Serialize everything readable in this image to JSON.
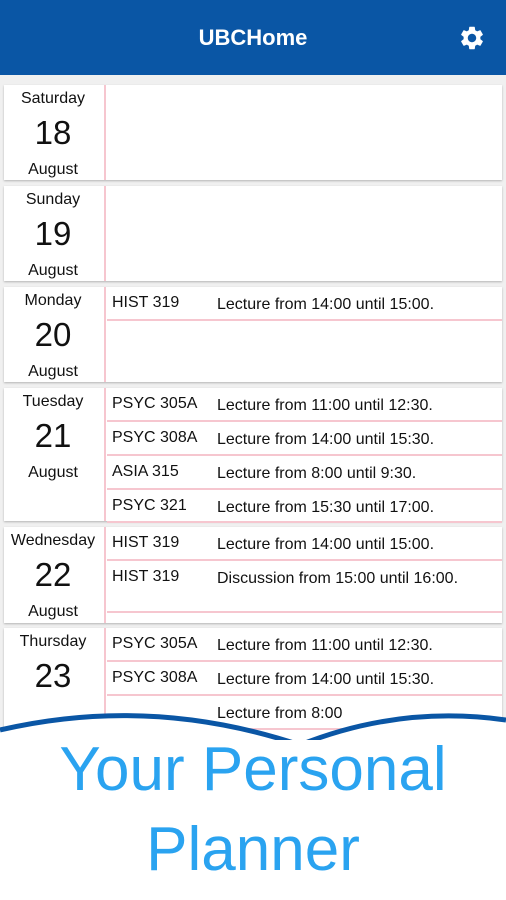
{
  "app": {
    "title": "UBCHome",
    "settings_icon": "gear-icon"
  },
  "days": [
    {
      "dow": "Saturday",
      "day": "18",
      "month": "August",
      "events": []
    },
    {
      "dow": "Sunday",
      "day": "19",
      "month": "August",
      "events": []
    },
    {
      "dow": "Monday",
      "day": "20",
      "month": "August",
      "events": [
        {
          "code": "HIST 319",
          "desc": "Lecture from 14:00 until 15:00."
        }
      ]
    },
    {
      "dow": "Tuesday",
      "day": "21",
      "month": "August",
      "events": [
        {
          "code": "PSYC 305A",
          "desc": "Lecture from 11:00 until 12:30."
        },
        {
          "code": "PSYC 308A",
          "desc": "Lecture from 14:00 until 15:30."
        },
        {
          "code": "ASIA 315",
          "desc": "Lecture from 8:00 until 9:30."
        },
        {
          "code": "PSYC 321",
          "desc": "Lecture from 15:30 until 17:00."
        }
      ]
    },
    {
      "dow": "Wednesday",
      "day": "22",
      "month": "August",
      "events": [
        {
          "code": "HIST 319",
          "desc": "Lecture from 14:00 until 15:00."
        },
        {
          "code": "HIST 319",
          "desc": "Discussion from 15:00 until 16:00."
        }
      ]
    },
    {
      "dow": "Thursday",
      "day": "23",
      "month": "",
      "events": [
        {
          "code": "PSYC 305A",
          "desc": "Lecture from 11:00 until 12:30."
        },
        {
          "code": "PSYC 308A",
          "desc": "Lecture from 14:00 until 15:30."
        },
        {
          "code": "",
          "desc": "Lecture from 8:00"
        }
      ]
    }
  ],
  "promo": {
    "line1": "Your Personal",
    "line2": "Planner"
  },
  "colors": {
    "appbar": "#0a56a5",
    "accent_line": "#f6c6cf",
    "promo_text": "#2aa3f0"
  }
}
